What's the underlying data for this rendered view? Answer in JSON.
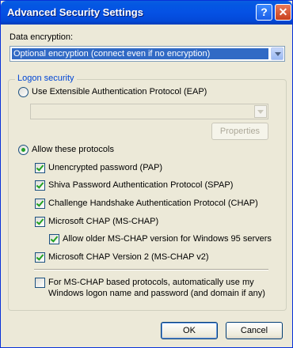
{
  "window": {
    "title": "Advanced Security Settings"
  },
  "titlebar": {
    "help_glyph": "?",
    "close_glyph": "✕"
  },
  "encryption": {
    "label": "Data encryption:",
    "selected": "Optional encryption (connect even if no encryption)"
  },
  "logon": {
    "group_label": "Logon security",
    "eap_option": "Use Extensible Authentication Protocol (EAP)",
    "eap_selected": false,
    "properties_label": "Properties",
    "allow_option": "Allow these protocols",
    "allow_selected": true,
    "protocols": [
      {
        "label": "Unencrypted password (PAP)",
        "checked": true
      },
      {
        "label": "Shiva Password Authentication Protocol (SPAP)",
        "checked": true
      },
      {
        "label": "Challenge Handshake Authentication Protocol (CHAP)",
        "checked": true
      },
      {
        "label": "Microsoft CHAP (MS-CHAP)",
        "checked": true
      },
      {
        "label": "Allow older MS-CHAP version for Windows 95 servers",
        "checked": true
      },
      {
        "label": "Microsoft CHAP Version 2 (MS-CHAP v2)",
        "checked": true
      }
    ],
    "auto_logon": {
      "line1": "For MS-CHAP based protocols, automatically use my",
      "line2": "Windows logon name and password (and domain if any)",
      "checked": false
    }
  },
  "footer": {
    "ok_label": "OK",
    "cancel_label": "Cancel"
  }
}
